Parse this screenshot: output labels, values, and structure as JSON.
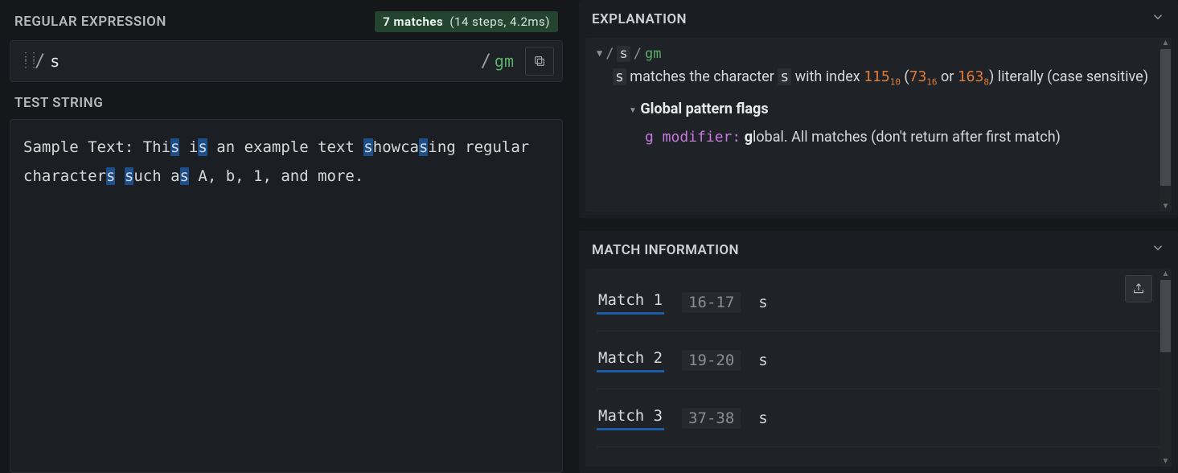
{
  "regex": {
    "header": "REGULAR EXPRESSION",
    "match_count": "7 matches",
    "match_stats": "(14 steps, 4.2ms)",
    "open_delim": "/",
    "pattern": "s",
    "close_delim": "/",
    "flags": "gm"
  },
  "test": {
    "header": "TEST STRING",
    "text_plain": "Sample Text: This is an example text showcasing regular characters such as A, b, 1, and more.",
    "segments": [
      {
        "t": "Sample Text: Thi",
        "h": false
      },
      {
        "t": "s",
        "h": true
      },
      {
        "t": " i",
        "h": false
      },
      {
        "t": "s",
        "h": true
      },
      {
        "t": " an example text ",
        "h": false
      },
      {
        "t": "s",
        "h": true
      },
      {
        "t": "howca",
        "h": false
      },
      {
        "t": "s",
        "h": true
      },
      {
        "t": "ing regular character",
        "h": false
      },
      {
        "t": "s",
        "h": true
      },
      {
        "t": " ",
        "h": false
      },
      {
        "t": "s",
        "h": true
      },
      {
        "t": "uch a",
        "h": false
      },
      {
        "t": "s",
        "h": true
      },
      {
        "t": " A, b, 1, and more.",
        "h": false
      }
    ]
  },
  "explanation": {
    "header": "EXPLANATION",
    "line1_pattern": "s",
    "line1_flags": "gm",
    "body_pre": " matches the character ",
    "body_char": "s",
    "body_mid": " with index ",
    "idx_dec": "115",
    "idx_dec_base": "10",
    "idx_hex": "73",
    "idx_hex_base": "16",
    "idx_oct": "163",
    "idx_oct_base": "8",
    "body_post": ") literally (case sensitive)",
    "flags_title": "Global pattern flags",
    "g_mod": "g modifier:",
    "g_desc_bold": "g",
    "g_desc_rest": "lobal. All matches (don't return after first match)"
  },
  "match_info": {
    "header": "MATCH INFORMATION",
    "matches": [
      {
        "name": "Match 1",
        "range": "16-17",
        "value": "s"
      },
      {
        "name": "Match 2",
        "range": "19-20",
        "value": "s"
      },
      {
        "name": "Match 3",
        "range": "37-38",
        "value": "s"
      }
    ]
  }
}
